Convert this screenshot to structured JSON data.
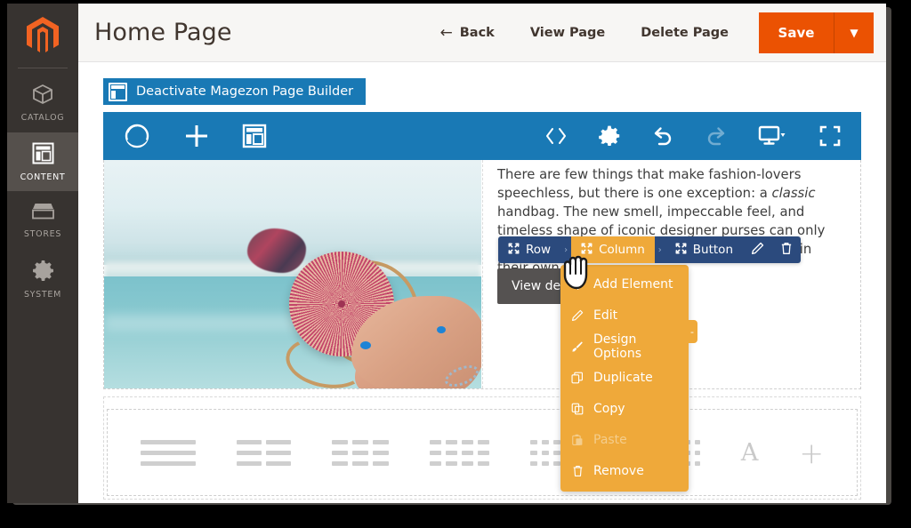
{
  "window": {
    "app": "Magento Admin"
  },
  "sidebar": {
    "logo": "magento-logo",
    "items": [
      {
        "label": "CATALOG",
        "icon": "box-icon",
        "active": false
      },
      {
        "label": "CONTENT",
        "icon": "layout-icon",
        "active": true
      },
      {
        "label": "STORES",
        "icon": "store-icon",
        "active": false
      },
      {
        "label": "SYSTEM",
        "icon": "gear-icon",
        "active": false
      }
    ]
  },
  "header": {
    "title": "Home Page",
    "back": "Back",
    "view_page": "View Page",
    "delete_page": "Delete Page",
    "save": "Save",
    "save_caret": "▼",
    "accent_orange": "#eb5202"
  },
  "builder": {
    "deactivate_button": "Deactivate Magezon Page Builder",
    "toolbar": {
      "brand_icon": "magezon-circle-icon",
      "add_icon": "plus-icon",
      "layout_icon": "layout-icon",
      "code_icon": "code-icon",
      "settings_icon": "gear-icon",
      "undo_icon": "undo-icon",
      "redo_icon": "redo-icon",
      "device_icon": "monitor-icon",
      "fullscreen_icon": "fullscreen-icon",
      "blue": "#1979b5"
    },
    "content": {
      "image_alt": "woman holding round rattan handbag at the beach",
      "paragraph_part1": "There are few things that make fashion-lovers speechless, but there is one exception: a ",
      "paragraph_italic": "classic",
      "paragraph_part2": " handbag. The new smell, impeccable feel, and timeless shape of iconic designer purses can only be described by somebody who has held one in their own",
      "view_details_button": "View details"
    },
    "breadcrumb": {
      "items": [
        {
          "label": "Row",
          "selected": false
        },
        {
          "label": "Column",
          "selected": true
        },
        {
          "label": "Button",
          "selected": false
        }
      ],
      "separator": "›",
      "edit_icon": "pencil-icon",
      "delete_icon": "trash-icon",
      "navy": "#2b4a7d",
      "amber": "#efa93a"
    },
    "context_menu": {
      "items": [
        {
          "label": "Add Element",
          "icon": "plus-icon",
          "disabled": false
        },
        {
          "label": "Edit",
          "icon": "pencil-icon",
          "disabled": false
        },
        {
          "label": "Design Options",
          "icon": "brush-icon",
          "disabled": false
        },
        {
          "label": "Duplicate",
          "icon": "duplicate-icon",
          "disabled": false
        },
        {
          "label": "Copy",
          "icon": "copy-icon",
          "disabled": false
        },
        {
          "label": "Paste",
          "icon": "paste-icon",
          "disabled": true
        },
        {
          "label": "Remove",
          "icon": "trash-icon",
          "disabled": false
        }
      ],
      "collapse_handle": "-"
    },
    "element_row": {
      "layouts": [
        {
          "name": "layout-1-column",
          "cols": 1
        },
        {
          "name": "layout-2-columns",
          "cols": 2
        },
        {
          "name": "layout-3-columns",
          "cols": 3
        },
        {
          "name": "layout-4-columns",
          "cols": 4
        },
        {
          "name": "layout-6-columns",
          "cols": 6
        },
        {
          "name": "layout-8-columns",
          "cols": 8
        }
      ],
      "text_element": "A",
      "add_element": "+"
    }
  },
  "cursor": {
    "type": "grab-hand-cursor"
  }
}
